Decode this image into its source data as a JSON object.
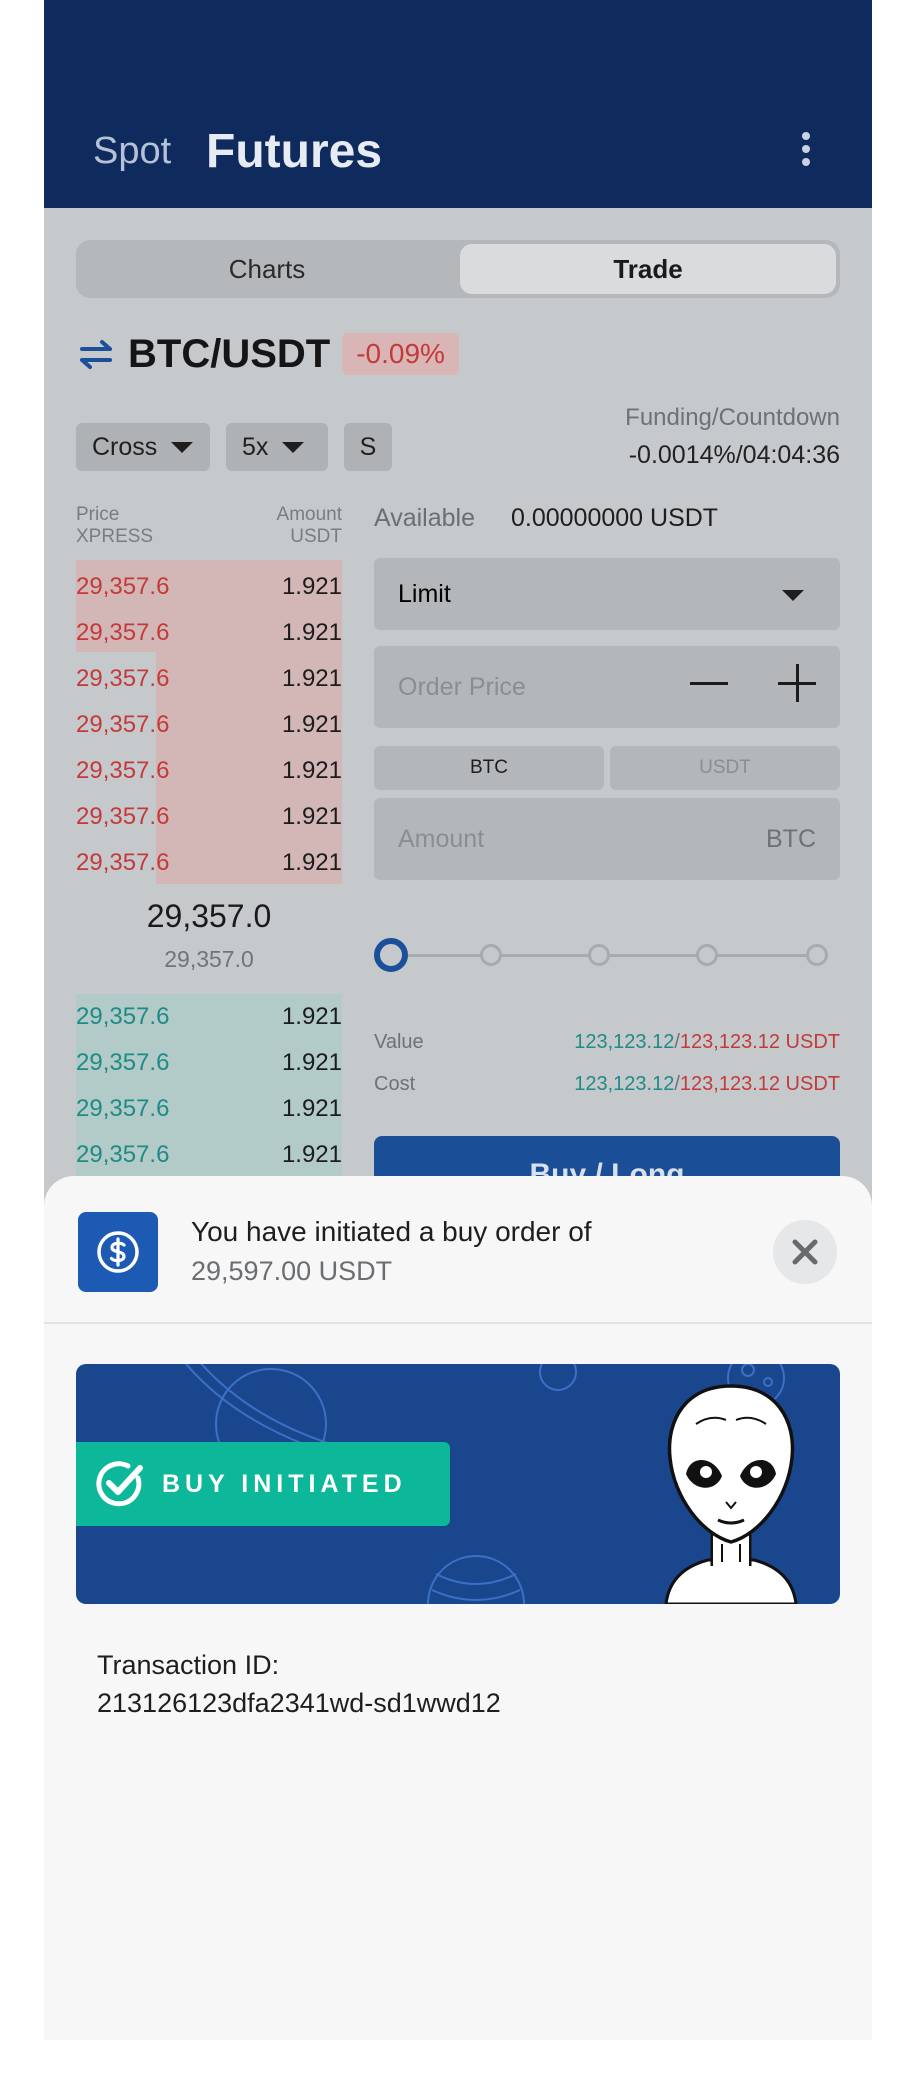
{
  "header": {
    "tabs": [
      {
        "label": "Spot",
        "active": false
      },
      {
        "label": "Futures",
        "active": true
      }
    ],
    "menu_icon": "more-vertical-icon"
  },
  "view_toggle": {
    "charts": "Charts",
    "trade": "Trade",
    "selected": "Trade"
  },
  "pair": {
    "symbol": "BTC/USDT",
    "change": "-0.09%",
    "swap_icon": "swap-arrows-icon"
  },
  "controls": {
    "margin_mode": "Cross",
    "leverage": "5x",
    "extra": "S"
  },
  "funding": {
    "label": "Funding/Countdown",
    "value": "-0.0014%/04:04:36"
  },
  "orderbook": {
    "price_header": "Price",
    "price_sub": "XPRESS",
    "amount_header": "Amount",
    "amount_sub": "USDT",
    "asks": [
      {
        "price": "29,357.6",
        "amount": "1.921"
      },
      {
        "price": "29,357.6",
        "amount": "1.921"
      },
      {
        "price": "29,357.6",
        "amount": "1.921"
      },
      {
        "price": "29,357.6",
        "amount": "1.921"
      },
      {
        "price": "29,357.6",
        "amount": "1.921"
      },
      {
        "price": "29,357.6",
        "amount": "1.921"
      },
      {
        "price": "29,357.6",
        "amount": "1.921"
      }
    ],
    "mid_price": "29,357.0",
    "mid_sub": "29,357.0",
    "bids": [
      {
        "price": "29,357.6",
        "amount": "1.921"
      },
      {
        "price": "29,357.6",
        "amount": "1.921"
      },
      {
        "price": "29,357.6",
        "amount": "1.921"
      },
      {
        "price": "29,357.6",
        "amount": "1.921"
      }
    ]
  },
  "order_form": {
    "available_label": "Available",
    "available_value": "0.00000000 USDT",
    "order_type": "Limit",
    "price_placeholder": "Order Price",
    "unit_options": [
      "BTC",
      "USDT"
    ],
    "selected_unit": "BTC",
    "amount_placeholder": "Amount",
    "amount_unit": "BTC",
    "slider_percent": 0,
    "value_label": "Value",
    "value_buy": "123,123.12",
    "value_sep": "/",
    "value_sell": "123,123.12 USDT",
    "cost_label": "Cost",
    "cost_buy": "123,123.12",
    "cost_sep": "/",
    "cost_sell": "123,123.12 USDT",
    "buy_label": "Buy / Long"
  },
  "sheet": {
    "icon": "dollar-circle-icon",
    "title": "You have initiated a buy order of",
    "amount": "29,597.00 USDT",
    "banner_text": "BUY INITIATED",
    "banner_icon": "check-circle-icon",
    "mascot": "alien-illustration",
    "txn_label": "Transaction ID:",
    "txn_id": "213126123dfa2341wd-sd1wwd12"
  },
  "colors": {
    "header_bg": "#0f2a5c",
    "primary": "#1c5ab3",
    "ask": "#c43a3a",
    "bid": "#1f8b86",
    "success": "#0cb899",
    "banner_bg": "#1a468e"
  }
}
